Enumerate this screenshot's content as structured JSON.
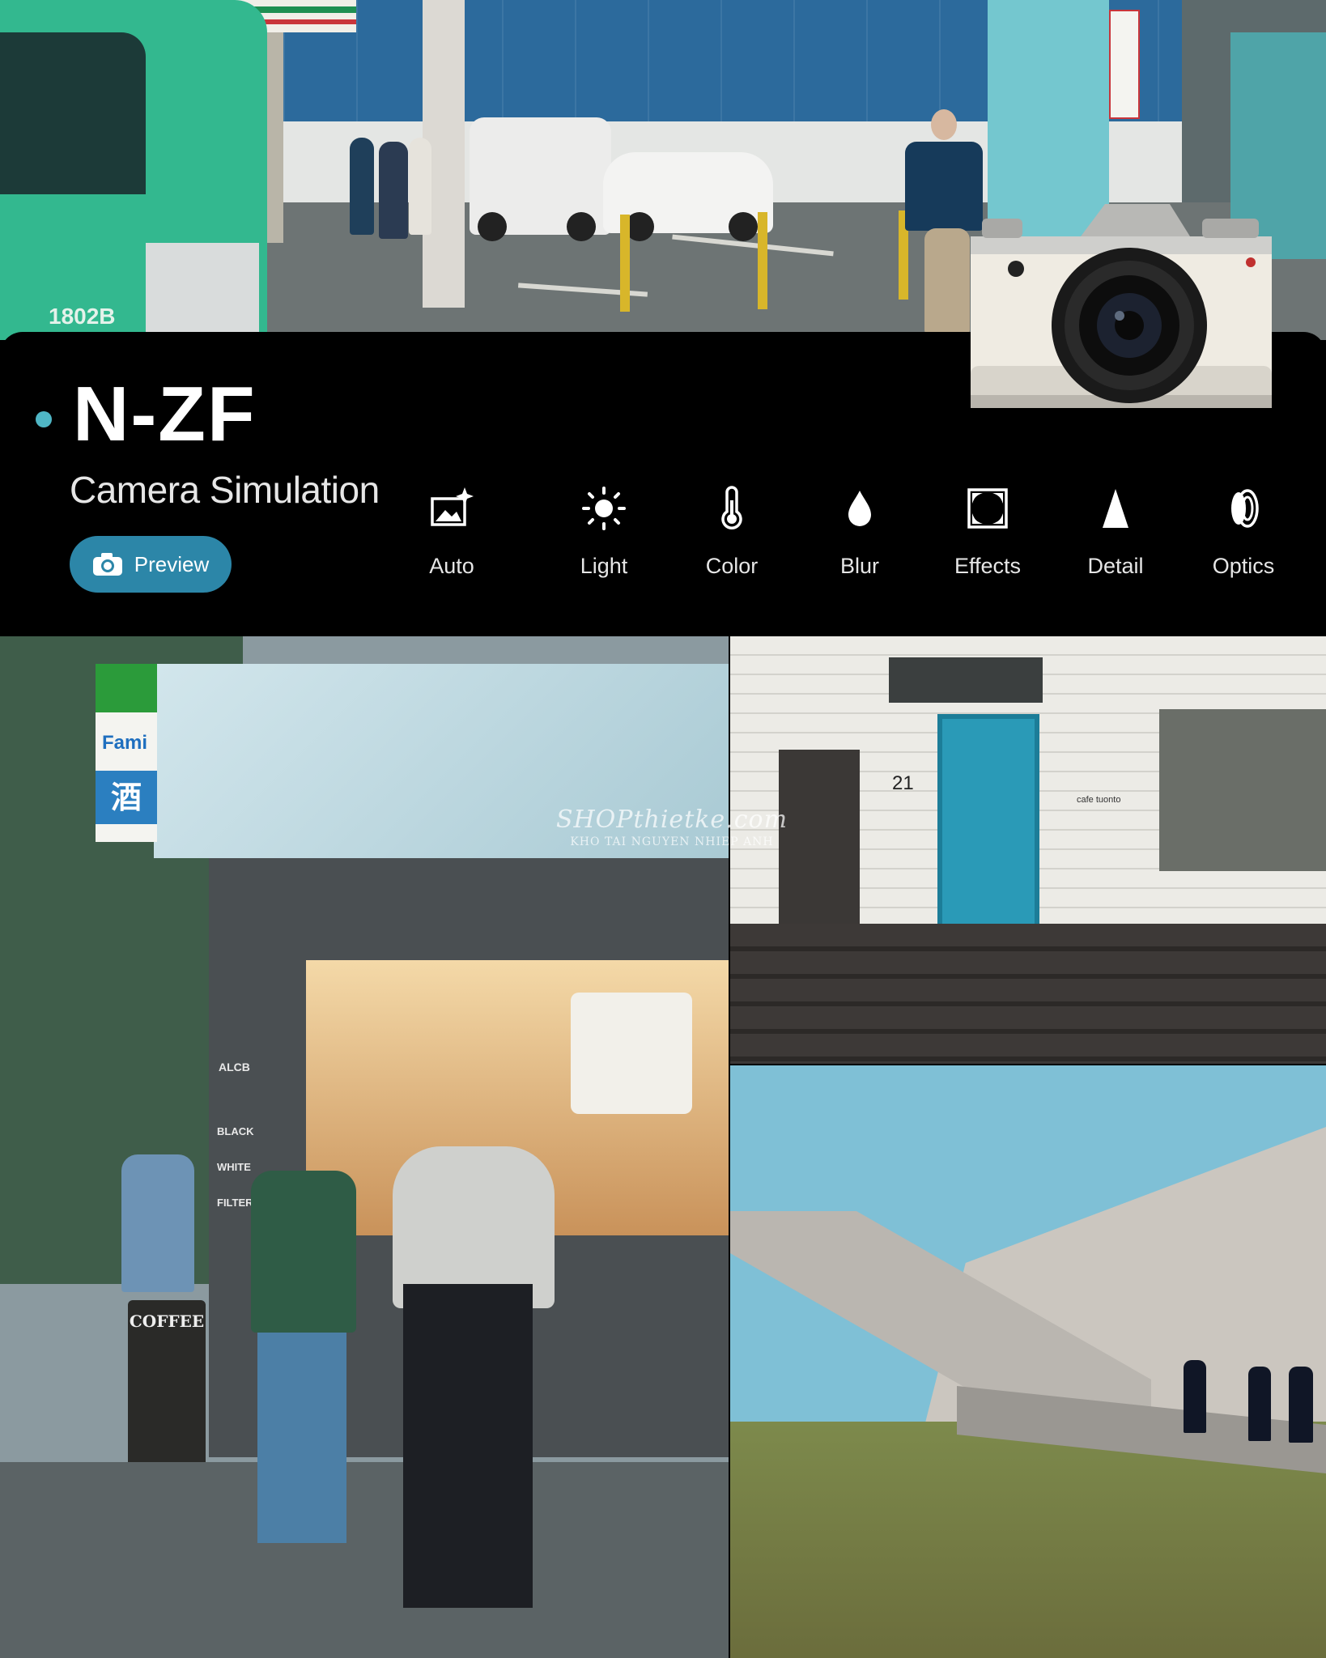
{
  "header": {
    "title": "N-ZF",
    "subtitle": "Camera Simulation",
    "preview_label": "Preview",
    "accent": "#4fb6c5",
    "button_color": "#2c86a8"
  },
  "tools": [
    {
      "label": "Auto",
      "icon": "auto-image-sparkle-icon"
    },
    {
      "label": "Light",
      "icon": "sun-icon"
    },
    {
      "label": "Color",
      "icon": "thermometer-icon"
    },
    {
      "label": "Blur",
      "icon": "droplet-icon"
    },
    {
      "label": "Effects",
      "icon": "vignette-frame-icon"
    },
    {
      "label": "Detail",
      "icon": "triangle-icon"
    },
    {
      "label": "Optics",
      "icon": "lens-icon"
    }
  ],
  "photos": {
    "top_truck_number": "1802B",
    "bottom_left_signs": {
      "store": "Fami",
      "kanji": "酒",
      "shop": "ALCB",
      "menu": [
        "BLACK",
        "WHITE",
        "FILTER"
      ],
      "board": "COFFEE"
    },
    "top_right_signs": {
      "house_number": "21",
      "cafe": "cafe tuonto"
    }
  },
  "watermark": {
    "line1": "SHOPthietke.com",
    "line2": "KHO TAI NGUYEN NHIEP ANH"
  }
}
